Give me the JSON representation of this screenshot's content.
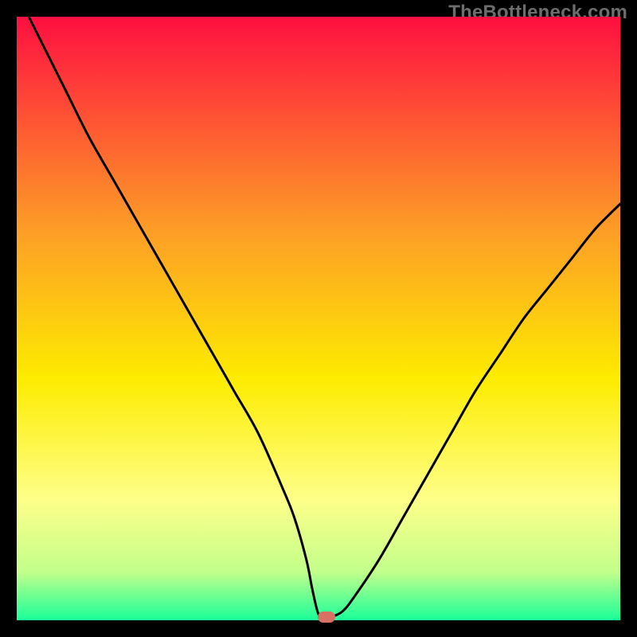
{
  "watermark": "TheBottleneck.com",
  "colors": {
    "gradient_top": "#fe0f40",
    "gradient_mid_upper": "#fd9c27",
    "gradient_mid": "#fdec00",
    "gradient_low1": "#feff89",
    "gradient_low2": "#c2ff8b",
    "gradient_bottom": "#19ff99",
    "curve": "#000000",
    "marker": "#d77164",
    "frame": "#000000"
  },
  "chart_data": {
    "type": "line",
    "title": "",
    "xlabel": "",
    "ylabel": "",
    "xlim": [
      0,
      100
    ],
    "ylim": [
      0,
      100
    ],
    "series": [
      {
        "name": "bottleneck-curve",
        "x": [
          2,
          4,
          8,
          12,
          16,
          20,
          24,
          28,
          32,
          36,
          40,
          44,
          46,
          48,
          49,
          50,
          51,
          52,
          54,
          56,
          60,
          64,
          68,
          72,
          76,
          80,
          84,
          88,
          92,
          96,
          100
        ],
        "values": [
          100,
          96,
          88,
          80,
          73,
          66,
          59,
          52,
          45,
          38,
          31,
          22,
          17,
          10,
          5,
          1,
          0.5,
          0.5,
          1.5,
          4,
          10,
          17,
          24,
          31,
          38,
          44,
          50,
          55,
          60,
          65,
          69
        ]
      }
    ],
    "marker": {
      "x": 51.3,
      "y": 0.5
    },
    "annotations": []
  }
}
